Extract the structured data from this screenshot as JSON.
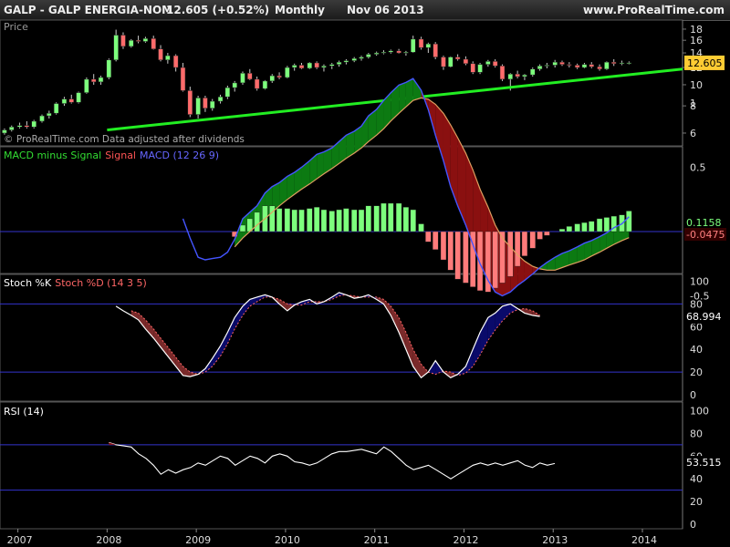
{
  "header": {
    "title": "GALP - GALP ENERGIA-NOM",
    "price_change": "12.605 (+0.52%)",
    "period": "Monthly",
    "date": "Nov 06 2013",
    "site": "www.ProRealTime.com"
  },
  "chart_data": [
    {
      "type": "candlestick",
      "title": "Price",
      "watermark": "© ProRealTime.com Data adjusted after dividends",
      "y_ticks": [
        6,
        8,
        10,
        12,
        14,
        16,
        18
      ],
      "last_value_label": "12.605",
      "last_value": 12.605,
      "trendline": {
        "from": {
          "year": 2008.0,
          "value": 6.2
        },
        "to": {
          "year": 2014.45,
          "value": 11.8
        },
        "color": "#22ee22"
      },
      "ohlc": [
        [
          2006.85,
          6.0,
          6.3,
          5.9,
          6.2
        ],
        [
          2006.93,
          6.2,
          6.5,
          6.1,
          6.4
        ],
        [
          2007.02,
          6.4,
          6.7,
          6.3,
          6.5
        ],
        [
          2007.1,
          6.5,
          6.8,
          6.3,
          6.4
        ],
        [
          2007.18,
          6.4,
          6.9,
          6.3,
          6.8
        ],
        [
          2007.27,
          6.8,
          7.3,
          6.7,
          7.2
        ],
        [
          2007.35,
          7.2,
          7.6,
          7.0,
          7.4
        ],
        [
          2007.43,
          7.4,
          8.3,
          7.3,
          8.2
        ],
        [
          2007.52,
          8.2,
          8.8,
          8.0,
          8.6
        ],
        [
          2007.6,
          8.6,
          9.0,
          8.2,
          8.3
        ],
        [
          2007.68,
          8.3,
          9.3,
          8.2,
          9.2
        ],
        [
          2007.77,
          9.2,
          10.8,
          9.1,
          10.6
        ],
        [
          2007.85,
          10.6,
          11.2,
          10.0,
          10.3
        ],
        [
          2007.93,
          10.3,
          11.0,
          10.0,
          10.8
        ],
        [
          2008.02,
          10.8,
          13.2,
          10.6,
          13.0
        ],
        [
          2008.1,
          13.0,
          17.9,
          12.8,
          16.9
        ],
        [
          2008.18,
          16.9,
          17.4,
          14.6,
          15.0
        ],
        [
          2008.27,
          15.0,
          16.2,
          14.8,
          16.0
        ],
        [
          2008.35,
          16.0,
          16.8,
          15.5,
          15.8
        ],
        [
          2008.43,
          15.8,
          16.6,
          15.6,
          16.3
        ],
        [
          2008.52,
          16.3,
          16.8,
          14.5,
          14.6
        ],
        [
          2008.6,
          14.6,
          15.2,
          12.8,
          13.0
        ],
        [
          2008.68,
          13.0,
          14.0,
          12.5,
          13.6
        ],
        [
          2008.77,
          13.6,
          13.8,
          11.5,
          12.0
        ],
        [
          2008.85,
          12.0,
          12.6,
          9.3,
          9.4
        ],
        [
          2008.93,
          9.4,
          9.8,
          7.1,
          7.3
        ],
        [
          2009.02,
          7.3,
          8.9,
          7.0,
          8.7
        ],
        [
          2009.1,
          8.7,
          8.9,
          7.5,
          7.8
        ],
        [
          2009.18,
          7.8,
          8.6,
          7.6,
          8.4
        ],
        [
          2009.27,
          8.4,
          9.0,
          8.2,
          8.8
        ],
        [
          2009.35,
          8.8,
          9.9,
          8.6,
          9.7
        ],
        [
          2009.43,
          9.7,
          10.4,
          9.3,
          10.2
        ],
        [
          2009.52,
          10.2,
          11.5,
          10.0,
          11.3
        ],
        [
          2009.6,
          11.3,
          11.8,
          10.5,
          10.6
        ],
        [
          2009.68,
          10.6,
          10.9,
          9.4,
          9.6
        ],
        [
          2009.77,
          9.6,
          10.5,
          9.5,
          10.4
        ],
        [
          2009.85,
          10.4,
          11.2,
          10.2,
          11.0
        ],
        [
          2009.93,
          11.0,
          11.4,
          10.6,
          10.8
        ],
        [
          2010.02,
          10.8,
          12.2,
          10.7,
          12.0
        ],
        [
          2010.1,
          12.0,
          12.5,
          11.6,
          12.3
        ],
        [
          2010.18,
          12.3,
          12.6,
          11.8,
          11.9
        ],
        [
          2010.27,
          11.9,
          12.7,
          11.8,
          12.6
        ],
        [
          2010.35,
          12.6,
          12.8,
          11.8,
          12.0
        ],
        [
          2010.43,
          12.0,
          12.4,
          11.5,
          12.2
        ],
        [
          2010.52,
          12.2,
          12.6,
          11.8,
          12.4
        ],
        [
          2010.6,
          12.4,
          12.9,
          12.1,
          12.7
        ],
        [
          2010.68,
          12.7,
          13.1,
          12.4,
          12.9
        ],
        [
          2010.77,
          12.9,
          13.4,
          12.7,
          13.2
        ],
        [
          2010.85,
          13.2,
          13.6,
          12.9,
          13.4
        ],
        [
          2010.93,
          13.4,
          14.0,
          13.2,
          13.8
        ],
        [
          2011.02,
          13.8,
          14.2,
          13.6,
          14.0
        ],
        [
          2011.1,
          14.0,
          14.4,
          13.8,
          14.1
        ],
        [
          2011.18,
          14.1,
          14.5,
          13.9,
          14.3
        ],
        [
          2011.27,
          14.3,
          14.6,
          13.9,
          14.0
        ],
        [
          2011.35,
          14.0,
          14.3,
          13.6,
          14.1
        ],
        [
          2011.43,
          14.1,
          16.8,
          14.0,
          16.2
        ],
        [
          2011.52,
          16.2,
          16.6,
          14.5,
          14.8
        ],
        [
          2011.6,
          14.8,
          15.6,
          14.0,
          15.4
        ],
        [
          2011.68,
          15.4,
          15.7,
          13.1,
          13.4
        ],
        [
          2011.77,
          13.4,
          13.6,
          11.7,
          12.1
        ],
        [
          2011.85,
          12.1,
          13.5,
          12.0,
          13.4
        ],
        [
          2011.93,
          13.4,
          13.8,
          12.9,
          13.1
        ],
        [
          2012.02,
          13.1,
          13.5,
          12.3,
          12.5
        ],
        [
          2012.1,
          12.5,
          12.8,
          11.2,
          11.4
        ],
        [
          2012.18,
          11.4,
          12.6,
          11.2,
          12.4
        ],
        [
          2012.27,
          12.4,
          13.0,
          12.1,
          12.8
        ],
        [
          2012.35,
          12.8,
          13.1,
          12.0,
          12.2
        ],
        [
          2012.43,
          12.2,
          12.4,
          10.4,
          10.6
        ],
        [
          2012.52,
          10.6,
          11.3,
          9.4,
          11.2
        ],
        [
          2012.6,
          11.2,
          11.6,
          10.7,
          10.9
        ],
        [
          2012.68,
          10.9,
          11.2,
          10.5,
          11.1
        ],
        [
          2012.77,
          11.1,
          12.0,
          10.9,
          11.8
        ],
        [
          2012.85,
          11.8,
          12.4,
          11.6,
          12.2
        ],
        [
          2012.93,
          12.2,
          12.6,
          11.9,
          12.3
        ],
        [
          2013.02,
          12.3,
          13.0,
          12.0,
          12.7
        ],
        [
          2013.1,
          12.7,
          12.9,
          12.2,
          12.4
        ],
        [
          2013.18,
          12.4,
          12.7,
          12.0,
          12.3
        ],
        [
          2013.27,
          12.3,
          12.5,
          11.8,
          12.0
        ],
        [
          2013.35,
          12.0,
          12.6,
          11.9,
          12.4
        ],
        [
          2013.43,
          12.4,
          12.7,
          11.9,
          12.1
        ],
        [
          2013.52,
          12.1,
          12.4,
          11.6,
          11.8
        ],
        [
          2013.6,
          11.8,
          12.8,
          11.7,
          12.7
        ],
        [
          2013.68,
          12.7,
          13.1,
          12.2,
          12.5
        ],
        [
          2013.77,
          12.5,
          12.9,
          12.3,
          12.6
        ],
        [
          2013.85,
          12.6,
          12.8,
          12.4,
          12.605
        ]
      ]
    },
    {
      "type": "macd",
      "legend": [
        {
          "text": "MACD minus Signal",
          "color": "#33dd33"
        },
        {
          "text": "Signal",
          "color": "#ff5555"
        },
        {
          "text": "MACD (12 26 9)",
          "color": "#6666ff"
        }
      ],
      "y_ticks": [
        1,
        0.5,
        0,
        -0.5
      ],
      "y_tick_labels": [
        "1",
        "0.5",
        "",
        "-0.5"
      ],
      "macd_label": "0.1158",
      "signal_label": "-0.0475",
      "x": [
        2008.85,
        2008.93,
        2009.02,
        2009.1,
        2009.18,
        2009.27,
        2009.35,
        2009.43,
        2009.52,
        2009.6,
        2009.68,
        2009.77,
        2009.85,
        2009.93,
        2010.02,
        2010.1,
        2010.18,
        2010.27,
        2010.35,
        2010.43,
        2010.52,
        2010.6,
        2010.68,
        2010.77,
        2010.85,
        2010.93,
        2011.02,
        2011.1,
        2011.18,
        2011.27,
        2011.35,
        2011.43,
        2011.52,
        2011.6,
        2011.68,
        2011.77,
        2011.85,
        2011.93,
        2012.02,
        2012.1,
        2012.18,
        2012.27,
        2012.35,
        2012.43,
        2012.52,
        2012.6,
        2012.68,
        2012.77,
        2012.85,
        2012.93,
        2013.02,
        2013.1,
        2013.18,
        2013.27,
        2013.35,
        2013.43,
        2013.52,
        2013.6,
        2013.68,
        2013.77,
        2013.85
      ],
      "macd": [
        0.1,
        -0.05,
        -0.2,
        -0.22,
        -0.21,
        -0.2,
        -0.16,
        -0.06,
        0.1,
        0.15,
        0.2,
        0.3,
        0.35,
        0.38,
        0.43,
        0.46,
        0.5,
        0.55,
        0.6,
        0.62,
        0.65,
        0.7,
        0.75,
        0.78,
        0.82,
        0.9,
        0.95,
        1.02,
        1.08,
        1.14,
        1.16,
        1.19,
        1.1,
        0.95,
        0.75,
        0.55,
        0.35,
        0.2,
        0.05,
        -0.1,
        -0.25,
        -0.38,
        -0.47,
        -0.5,
        -0.47,
        -0.42,
        -0.38,
        -0.33,
        -0.28,
        -0.24,
        -0.2,
        -0.17,
        -0.15,
        -0.12,
        -0.09,
        -0.07,
        -0.04,
        -0.01,
        0.03,
        0.06,
        0.1158
      ],
      "signal": [
        null,
        null,
        null,
        null,
        null,
        null,
        null,
        -0.12,
        -0.05,
        0.0,
        0.05,
        0.1,
        0.15,
        0.2,
        0.25,
        0.29,
        0.33,
        0.37,
        0.41,
        0.45,
        0.49,
        0.53,
        0.57,
        0.61,
        0.65,
        0.7,
        0.75,
        0.8,
        0.86,
        0.92,
        0.97,
        1.02,
        1.04,
        1.03,
        0.99,
        0.92,
        0.83,
        0.73,
        0.61,
        0.48,
        0.33,
        0.19,
        0.05,
        -0.05,
        -0.12,
        -0.18,
        -0.23,
        -0.27,
        -0.29,
        -0.3,
        -0.3,
        -0.28,
        -0.26,
        -0.24,
        -0.22,
        -0.19,
        -0.16,
        -0.13,
        -0.1,
        -0.07,
        -0.0475
      ],
      "histogram": [
        null,
        null,
        null,
        null,
        null,
        null,
        null,
        -0.04,
        0.05,
        0.1,
        0.15,
        0.2,
        0.2,
        0.18,
        0.18,
        0.17,
        0.17,
        0.18,
        0.19,
        0.17,
        0.16,
        0.17,
        0.18,
        0.17,
        0.17,
        0.2,
        0.2,
        0.22,
        0.22,
        0.22,
        0.19,
        0.17,
        0.06,
        -0.08,
        -0.14,
        -0.22,
        -0.3,
        -0.37,
        -0.4,
        -0.43,
        -0.46,
        -0.47,
        -0.44,
        -0.4,
        -0.35,
        -0.27,
        -0.19,
        -0.13,
        -0.06,
        -0.03,
        0.0,
        0.02,
        0.04,
        0.06,
        0.07,
        0.08,
        0.1,
        0.11,
        0.12,
        0.13,
        0.16
      ]
    },
    {
      "type": "stochastic",
      "legend": [
        {
          "text": "Stoch %K",
          "color": "#ffffff"
        },
        {
          "text": "Stoch %D (14 3 5)",
          "color": "#ff6666"
        }
      ],
      "y_ticks": [
        0,
        20,
        40,
        60,
        80,
        100
      ],
      "levels": [
        20,
        80
      ],
      "k_label": "68.994",
      "x": [
        2008.1,
        2008.18,
        2008.27,
        2008.35,
        2008.43,
        2008.52,
        2008.6,
        2008.68,
        2008.77,
        2008.85,
        2008.93,
        2009.02,
        2009.1,
        2009.18,
        2009.27,
        2009.35,
        2009.43,
        2009.52,
        2009.6,
        2009.68,
        2009.77,
        2009.85,
        2009.93,
        2010.02,
        2010.1,
        2010.18,
        2010.27,
        2010.35,
        2010.43,
        2010.52,
        2010.6,
        2010.68,
        2010.77,
        2010.85,
        2010.93,
        2011.02,
        2011.1,
        2011.18,
        2011.27,
        2011.35,
        2011.43,
        2011.52,
        2011.6,
        2011.68,
        2011.77,
        2011.85,
        2011.93,
        2012.02,
        2012.1,
        2012.18,
        2012.27,
        2012.35,
        2012.43,
        2012.52,
        2012.6,
        2012.68,
        2012.77,
        2012.85,
        2012.93,
        2013.02,
        2013.1,
        2013.18,
        2013.27,
        2013.35,
        2013.43,
        2013.52,
        2013.6,
        2013.68,
        2013.77,
        2013.85
      ],
      "k": [
        78,
        74,
        70,
        66,
        58,
        50,
        42,
        34,
        25,
        17,
        16,
        18,
        23,
        32,
        43,
        55,
        68,
        78,
        84,
        86,
        88,
        86,
        80,
        74,
        79,
        82,
        84,
        80,
        82,
        86,
        90,
        88,
        85,
        86,
        88,
        84,
        80,
        70,
        55,
        40,
        25,
        15,
        20,
        30,
        20,
        15,
        18,
        25,
        40,
        55,
        68,
        72,
        78,
        80,
        76,
        72,
        70,
        69
      ],
      "d": [
        null,
        null,
        74,
        72,
        66,
        58,
        50,
        42,
        33,
        25,
        20,
        18,
        20,
        25,
        34,
        45,
        58,
        70,
        78,
        82,
        86,
        86,
        84,
        80,
        79,
        79,
        82,
        82,
        82,
        84,
        87,
        88,
        87,
        86,
        86,
        86,
        84,
        78,
        68,
        55,
        40,
        27,
        20,
        18,
        21,
        20,
        17,
        19,
        25,
        35,
        48,
        57,
        65,
        72,
        75,
        76,
        74,
        70
      ],
      "k_x_start": 2008.1
    },
    {
      "type": "rsi",
      "legend": [
        {
          "text": "RSI (14)",
          "color": "#ffffff"
        }
      ],
      "y_ticks": [
        0,
        20,
        40,
        60,
        80,
        100
      ],
      "levels": [
        30,
        70
      ],
      "value_label": "53.515",
      "values": [
        72,
        70,
        69,
        68,
        62,
        58,
        52,
        44,
        48,
        45,
        48,
        50,
        54,
        52,
        56,
        60,
        58,
        52,
        56,
        60,
        58,
        54,
        60,
        62,
        60,
        55,
        54,
        52,
        54,
        58,
        62,
        64,
        64,
        65,
        66,
        64,
        62,
        68,
        64,
        58,
        52,
        48,
        50,
        52,
        48,
        44,
        40,
        44,
        48,
        52,
        54,
        52,
        54,
        52,
        54,
        56,
        52,
        50,
        54,
        52,
        53.515
      ],
      "x_start": 2008.02,
      "x_step": 0.0833
    }
  ],
  "x_axis": {
    "ticks": [
      2007,
      2008,
      2009,
      2010,
      2011,
      2012,
      2013,
      2014
    ],
    "labels": [
      "2007",
      "2008",
      "2009",
      "2010",
      "2011",
      "2012",
      "2013",
      "2014"
    ]
  }
}
